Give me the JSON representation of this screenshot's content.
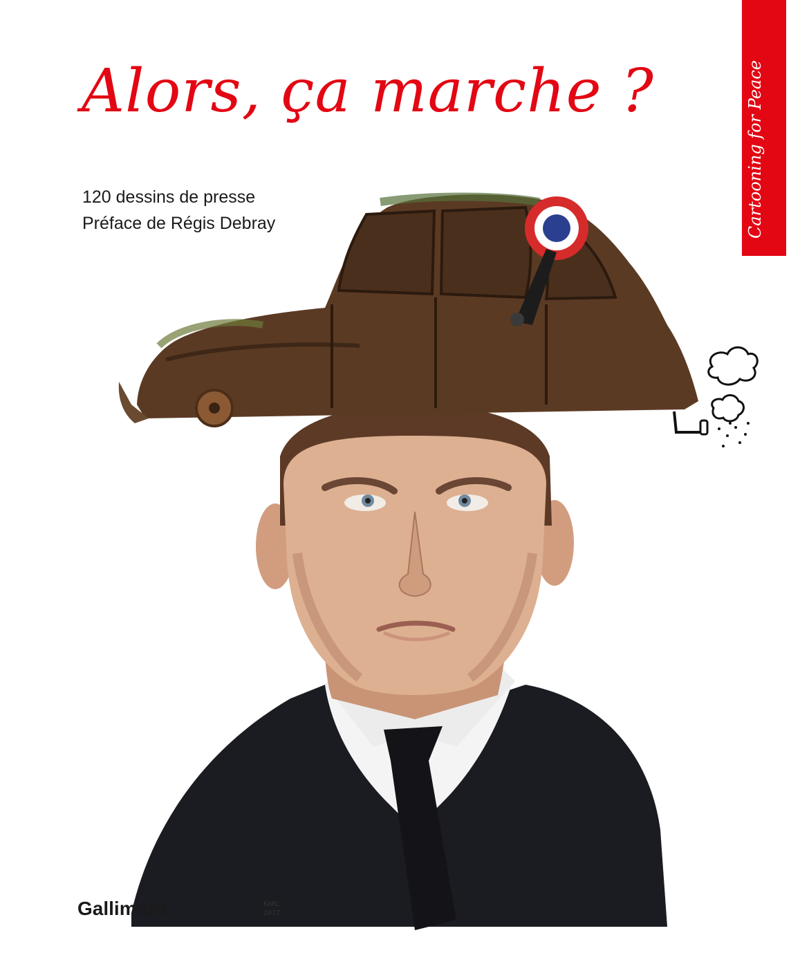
{
  "cover": {
    "title": "Alors, ça marche ?",
    "subtitle_line1": "120 dessins de presse",
    "subtitle_line2": "Préface de Régis Debray",
    "series": "Cartooning for Peace",
    "publisher": "Gallimard",
    "signature_name": "KARL",
    "signature_year": "2017"
  },
  "colors": {
    "accent_red": "#e30613",
    "suit": "#1b1c22",
    "skin": "#d9a887",
    "rust": "#5b3a24"
  }
}
